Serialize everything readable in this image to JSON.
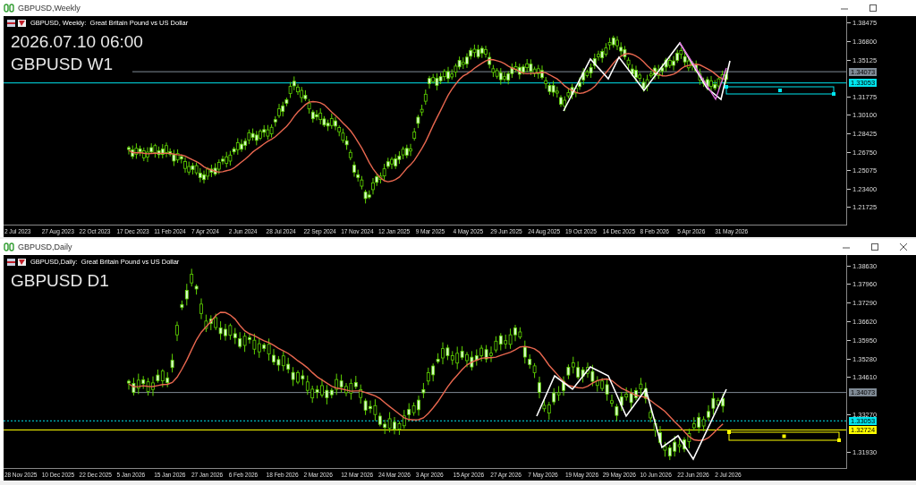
{
  "windows": [
    {
      "title": "GBPUSD,Weekly",
      "closable": false,
      "kind": "weekly",
      "header": "GBPUSD, Weekly:  Great Britain Pound vs US Dollar",
      "overlay": [
        "2026.07.10 06:00",
        "GBPUSD W1"
      ],
      "price_ticks": [
        "1.38475",
        "1.36800",
        "1.35125",
        "1.31775",
        "1.30100",
        "1.28425",
        "1.26750",
        "1.25075",
        "1.23400",
        "1.21725"
      ],
      "price_markers": [
        {
          "label": "1.34073",
          "color": "#808b96",
          "kind": "solid"
        },
        {
          "label": "1.33053",
          "color": "#00e5ee",
          "kind": "solid"
        }
      ],
      "time_labels": [
        "2 Jul 2023",
        "27 Aug 2023",
        "22 Oct 2023",
        "17 Dec 2023",
        "11 Feb 2024",
        "7 Apr 2024",
        "2 Jun 2024",
        "28 Jul 2024",
        "22 Sep 2024",
        "17 Nov 2024",
        "12 Jan 2025",
        "9 Mar 2025",
        "4 May 2025",
        "29 Jun 2025",
        "24 Aug 2025",
        "19 Oct 2025",
        "14 Dec 2025",
        "8 Feb 2026",
        "5 Apr 2026",
        "31 May 2026"
      ]
    },
    {
      "title": "GBPUSD,Daily",
      "closable": true,
      "kind": "daily",
      "header": "GBPUSD,Daily:  Great Britain Pound vs US Dollar",
      "overlay": [
        "GBPUSD D1"
      ],
      "price_ticks": [
        "1.38630",
        "1.37960",
        "1.37290",
        "1.36620",
        "1.35950",
        "1.35280",
        "1.34610",
        "1.33270",
        "1.31930"
      ],
      "price_markers": [
        {
          "label": "1.34073",
          "color": "#808b96",
          "kind": "solid"
        },
        {
          "label": "1.33053",
          "color": "#00e5ee",
          "kind": "dotted"
        },
        {
          "label": "1.32724",
          "color": "#ffff00",
          "kind": "solid"
        }
      ],
      "time_labels": [
        "28 Nov 2025",
        "10 Dec 2025",
        "22 Dec 2025",
        "5 Jan 2026",
        "15 Jan 2026",
        "27 Jan 2026",
        "6 Feb 2026",
        "18 Feb 2026",
        "2 Mar 2026",
        "12 Mar 2026",
        "24 Mar 2026",
        "3 Apr 2026",
        "15 Apr 2026",
        "27 Apr 2026",
        "7 May 2026",
        "19 May 2026",
        "29 May 2026",
        "10 Jun 2026",
        "22 Jun 2026",
        "2 Jul 2026"
      ]
    }
  ]
}
